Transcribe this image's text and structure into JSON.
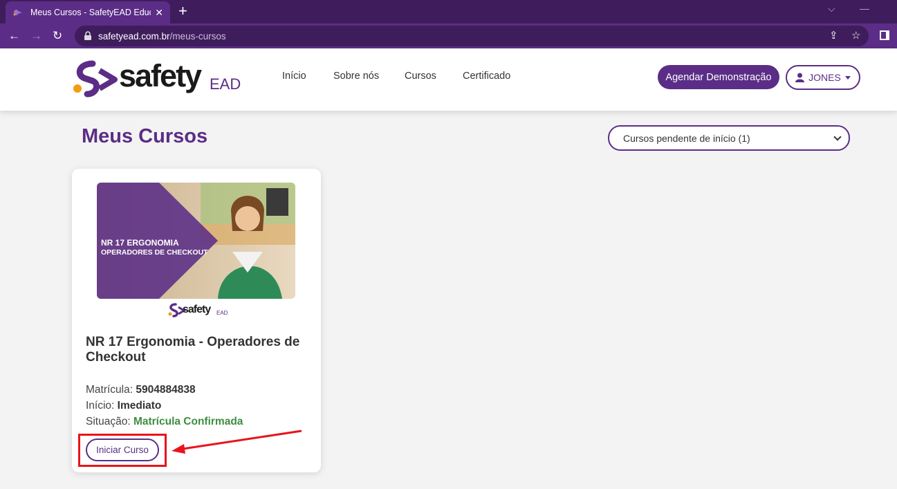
{
  "browser": {
    "tab_title": "Meus Cursos - SafetyEAD Educaç",
    "url_domain": "safetyead.com.br",
    "url_path": "/meus-cursos"
  },
  "header": {
    "logo_word": "safety",
    "logo_suffix": "EAD",
    "nav": [
      "Início",
      "Sobre nós",
      "Cursos",
      "Certificado"
    ],
    "demo_button": "Agendar Demonstração",
    "user_name": "JONES"
  },
  "main": {
    "page_title": "Meus Cursos",
    "filter_value": "Cursos pendente de início (1)",
    "course": {
      "thumb_line1": "NR 17 ERGONOMIA",
      "thumb_line2": "OPERADORES DE CHECKOUT",
      "title": "NR 17 Ergonomia - Operadores de Checkout",
      "matricula_label": "Matrícula:",
      "matricula_value": "5904884838",
      "inicio_label": "Início:",
      "inicio_value": "Imediato",
      "situacao_label": "Situação:",
      "situacao_value": "Matrícula Confirmada",
      "start_button": "Iniciar Curso"
    }
  },
  "colors": {
    "brand": "#5b2d86",
    "success": "#3e8e41",
    "annotation": "#e8141c"
  }
}
